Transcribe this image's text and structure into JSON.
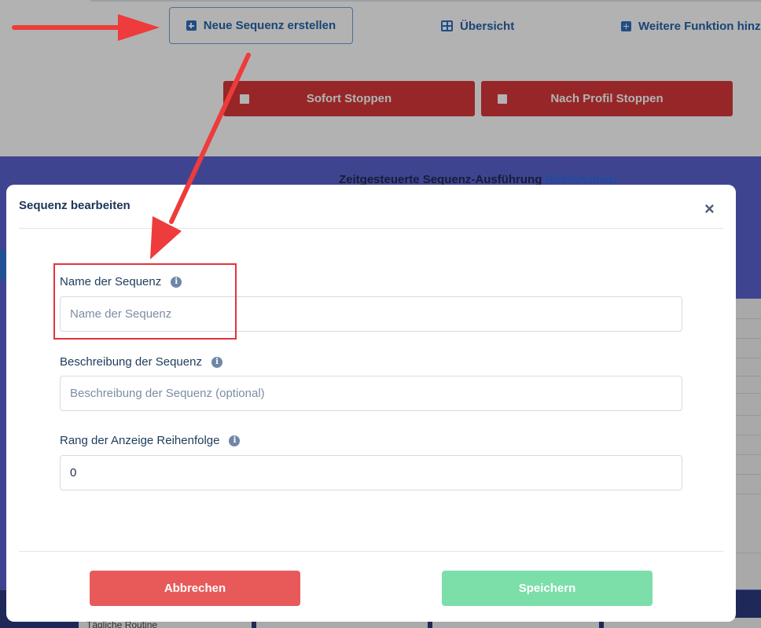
{
  "toolbar": {
    "new_sequence_label": "Neue Sequenz erstellen",
    "overview_label": "Übersicht",
    "more_function_label": "Weitere Funktion hinz",
    "stop_now_label": "Sofort Stoppen",
    "stop_by_profile_label": "Nach Profil Stoppen"
  },
  "background": {
    "section_title": "Zeitgesteuerte Sequenz-Ausführung",
    "section_link": "(Erklärvideo)",
    "card_label": "Tägliche Routine"
  },
  "modal": {
    "title": "Sequenz bearbeiten",
    "close_symbol": "×",
    "fields": [
      {
        "label": "Name der Sequenz",
        "placeholder": "Name der Sequenz",
        "value": ""
      },
      {
        "label": "Beschreibung der Sequenz",
        "placeholder": "Beschreibung der Sequenz (optional)",
        "value": ""
      },
      {
        "label": "Rang der Anzeige Reihenfolge",
        "placeholder": "",
        "value": "0"
      }
    ],
    "cancel_label": "Abbrechen",
    "save_label": "Speichern"
  },
  "colors": {
    "primary_blue": "#2f6fc2",
    "stop_red": "#d9373a",
    "cancel_red": "#e85a5a",
    "save_green": "#7cdfa9",
    "annotation_red": "#e0353a"
  },
  "icons": {
    "info": "i",
    "new_sequence": "plus-square-icon",
    "overview": "grid-icon",
    "more_function": "plus-square-icon",
    "stop": "stop-square-icon"
  }
}
